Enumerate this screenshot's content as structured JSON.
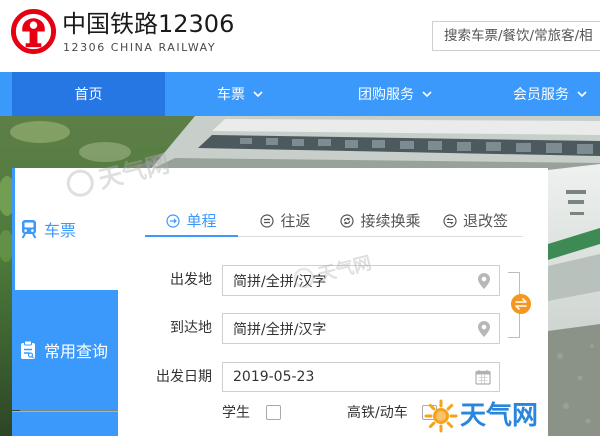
{
  "colors": {
    "brand_red": "#e60012",
    "nav_bg": "#3b99fc",
    "nav_active_bg": "#2676e3",
    "accent_blue": "#3b99fc",
    "swap_orange": "#f5961e",
    "watermark_blue": "#2a86dc"
  },
  "header": {
    "logo_icon": "china-railway-logo-icon",
    "brand_title": "中国铁路12306",
    "brand_subtitle": "12306 CHINA RAILWAY",
    "search": {
      "placeholder": "搜索车票/餐饮/常旅客/相"
    }
  },
  "nav": {
    "dropdown_icon": "chevron-down-icon",
    "items": [
      {
        "label": "首页",
        "active": true,
        "has_dropdown": false
      },
      {
        "label": "车票",
        "active": false,
        "has_dropdown": true
      },
      {
        "label": "团购服务",
        "active": false,
        "has_dropdown": true
      },
      {
        "label": "会员服务",
        "active": false,
        "has_dropdown": true
      }
    ]
  },
  "side_tabs": [
    {
      "label": "车票",
      "icon": "train-icon",
      "active": true
    },
    {
      "label": "常用查询",
      "icon": "clipboard-icon",
      "active": false
    }
  ],
  "ticket_tabs": [
    {
      "label": "单程",
      "icon": "one-way-circle-icon",
      "active": true
    },
    {
      "label": "往返",
      "icon": "round-trip-circle-icon",
      "active": false
    },
    {
      "label": "接续换乘",
      "icon": "transfer-circle-icon",
      "active": false
    },
    {
      "label": "退改签",
      "icon": "refund-circle-icon",
      "active": false
    }
  ],
  "form": {
    "from": {
      "label": "出发地",
      "value": "简拼/全拼/汉字",
      "icon": "location-pin-icon"
    },
    "to": {
      "label": "到达地",
      "value": "简拼/全拼/汉字",
      "icon": "location-pin-icon"
    },
    "swap_icon": "swap-arrows-icon",
    "date": {
      "label": "出发日期",
      "value": "2019-05-23",
      "icon": "calendar-icon"
    },
    "student": {
      "label": "学生",
      "checked": false
    },
    "high_speed": {
      "label": "高铁/动车",
      "checked": false
    }
  },
  "watermark": {
    "text": "天气网",
    "icon": "sun-icon"
  }
}
